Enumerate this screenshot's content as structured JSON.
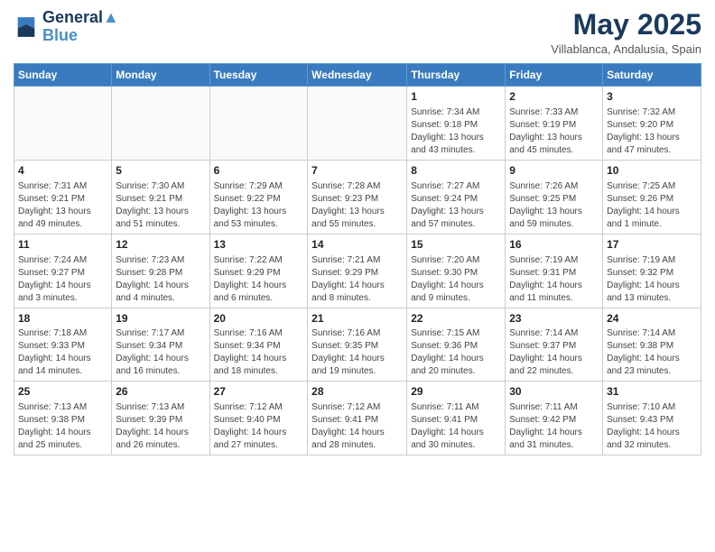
{
  "header": {
    "logo_line1": "General",
    "logo_line2": "Blue",
    "month": "May 2025",
    "location": "Villablanca, Andalusia, Spain"
  },
  "weekdays": [
    "Sunday",
    "Monday",
    "Tuesday",
    "Wednesday",
    "Thursday",
    "Friday",
    "Saturday"
  ],
  "weeks": [
    [
      {
        "day": "",
        "detail": ""
      },
      {
        "day": "",
        "detail": ""
      },
      {
        "day": "",
        "detail": ""
      },
      {
        "day": "",
        "detail": ""
      },
      {
        "day": "1",
        "detail": "Sunrise: 7:34 AM\nSunset: 9:18 PM\nDaylight: 13 hours\nand 43 minutes."
      },
      {
        "day": "2",
        "detail": "Sunrise: 7:33 AM\nSunset: 9:19 PM\nDaylight: 13 hours\nand 45 minutes."
      },
      {
        "day": "3",
        "detail": "Sunrise: 7:32 AM\nSunset: 9:20 PM\nDaylight: 13 hours\nand 47 minutes."
      }
    ],
    [
      {
        "day": "4",
        "detail": "Sunrise: 7:31 AM\nSunset: 9:21 PM\nDaylight: 13 hours\nand 49 minutes."
      },
      {
        "day": "5",
        "detail": "Sunrise: 7:30 AM\nSunset: 9:21 PM\nDaylight: 13 hours\nand 51 minutes."
      },
      {
        "day": "6",
        "detail": "Sunrise: 7:29 AM\nSunset: 9:22 PM\nDaylight: 13 hours\nand 53 minutes."
      },
      {
        "day": "7",
        "detail": "Sunrise: 7:28 AM\nSunset: 9:23 PM\nDaylight: 13 hours\nand 55 minutes."
      },
      {
        "day": "8",
        "detail": "Sunrise: 7:27 AM\nSunset: 9:24 PM\nDaylight: 13 hours\nand 57 minutes."
      },
      {
        "day": "9",
        "detail": "Sunrise: 7:26 AM\nSunset: 9:25 PM\nDaylight: 13 hours\nand 59 minutes."
      },
      {
        "day": "10",
        "detail": "Sunrise: 7:25 AM\nSunset: 9:26 PM\nDaylight: 14 hours\nand 1 minute."
      }
    ],
    [
      {
        "day": "11",
        "detail": "Sunrise: 7:24 AM\nSunset: 9:27 PM\nDaylight: 14 hours\nand 3 minutes."
      },
      {
        "day": "12",
        "detail": "Sunrise: 7:23 AM\nSunset: 9:28 PM\nDaylight: 14 hours\nand 4 minutes."
      },
      {
        "day": "13",
        "detail": "Sunrise: 7:22 AM\nSunset: 9:29 PM\nDaylight: 14 hours\nand 6 minutes."
      },
      {
        "day": "14",
        "detail": "Sunrise: 7:21 AM\nSunset: 9:29 PM\nDaylight: 14 hours\nand 8 minutes."
      },
      {
        "day": "15",
        "detail": "Sunrise: 7:20 AM\nSunset: 9:30 PM\nDaylight: 14 hours\nand 9 minutes."
      },
      {
        "day": "16",
        "detail": "Sunrise: 7:19 AM\nSunset: 9:31 PM\nDaylight: 14 hours\nand 11 minutes."
      },
      {
        "day": "17",
        "detail": "Sunrise: 7:19 AM\nSunset: 9:32 PM\nDaylight: 14 hours\nand 13 minutes."
      }
    ],
    [
      {
        "day": "18",
        "detail": "Sunrise: 7:18 AM\nSunset: 9:33 PM\nDaylight: 14 hours\nand 14 minutes."
      },
      {
        "day": "19",
        "detail": "Sunrise: 7:17 AM\nSunset: 9:34 PM\nDaylight: 14 hours\nand 16 minutes."
      },
      {
        "day": "20",
        "detail": "Sunrise: 7:16 AM\nSunset: 9:34 PM\nDaylight: 14 hours\nand 18 minutes."
      },
      {
        "day": "21",
        "detail": "Sunrise: 7:16 AM\nSunset: 9:35 PM\nDaylight: 14 hours\nand 19 minutes."
      },
      {
        "day": "22",
        "detail": "Sunrise: 7:15 AM\nSunset: 9:36 PM\nDaylight: 14 hours\nand 20 minutes."
      },
      {
        "day": "23",
        "detail": "Sunrise: 7:14 AM\nSunset: 9:37 PM\nDaylight: 14 hours\nand 22 minutes."
      },
      {
        "day": "24",
        "detail": "Sunrise: 7:14 AM\nSunset: 9:38 PM\nDaylight: 14 hours\nand 23 minutes."
      }
    ],
    [
      {
        "day": "25",
        "detail": "Sunrise: 7:13 AM\nSunset: 9:38 PM\nDaylight: 14 hours\nand 25 minutes."
      },
      {
        "day": "26",
        "detail": "Sunrise: 7:13 AM\nSunset: 9:39 PM\nDaylight: 14 hours\nand 26 minutes."
      },
      {
        "day": "27",
        "detail": "Sunrise: 7:12 AM\nSunset: 9:40 PM\nDaylight: 14 hours\nand 27 minutes."
      },
      {
        "day": "28",
        "detail": "Sunrise: 7:12 AM\nSunset: 9:41 PM\nDaylight: 14 hours\nand 28 minutes."
      },
      {
        "day": "29",
        "detail": "Sunrise: 7:11 AM\nSunset: 9:41 PM\nDaylight: 14 hours\nand 30 minutes."
      },
      {
        "day": "30",
        "detail": "Sunrise: 7:11 AM\nSunset: 9:42 PM\nDaylight: 14 hours\nand 31 minutes."
      },
      {
        "day": "31",
        "detail": "Sunrise: 7:10 AM\nSunset: 9:43 PM\nDaylight: 14 hours\nand 32 minutes."
      }
    ]
  ]
}
